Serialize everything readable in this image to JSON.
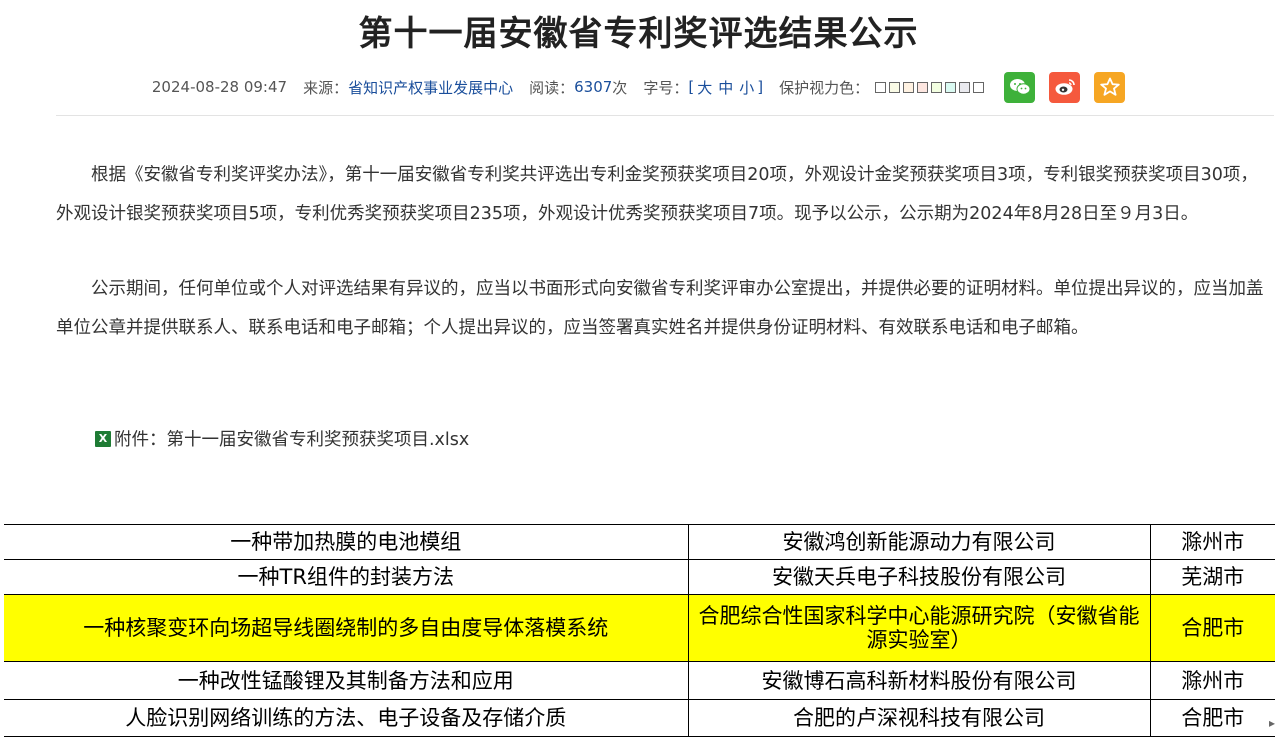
{
  "article": {
    "title": "第十一届安徽省专利奖评选结果公示",
    "date": "2024-08-28 09:47",
    "source_label": "来源：",
    "source": "省知识产权事业发展中心",
    "reads_label": "阅读：",
    "reads": "6307",
    "reads_unit": "次",
    "font_size_label": "字号：",
    "font_open": "[",
    "font_large": "大",
    "font_medium": "中",
    "font_small": "小",
    "font_close": "]",
    "eye_color_label": "保护视力色：",
    "eye_colors": [
      "#ffffff",
      "#fafbe6",
      "#fff2e2",
      "#fde6e0",
      "#f3ffe1",
      "#dafaf2",
      "#eaeaef",
      "#ffffff"
    ]
  },
  "share": {
    "wechat_icon": "wechat-icon",
    "weibo_icon": "weibo-icon",
    "favorite_icon": "star-icon",
    "wechat_color": "#3eb13a",
    "weibo_color": "#f5593d",
    "favorite_color": "#f6a623"
  },
  "content": {
    "paragraph1": "根据《安徽省专利奖评奖办法》，第十一届安徽省专利奖共评选出专利金奖预获奖项目20项，外观设计金奖预获奖项目3项，专利银奖预获奖项目30项，外观设计银奖预获奖项目5项，专利优秀奖预获奖项目235项，外观设计优秀奖预获奖项目7项。现予以公示，公示期为2024年8月28日至９月3日。",
    "paragraph2": "公示期间，任何单位或个人对评选结果有异议的，应当以书面形式向安徽省专利奖评审办公室提出，并提供必要的证明材料。单位提出异议的，应当加盖单位公章并提供联系人、联系电话和电子邮箱；个人提出异议的，应当签署真实姓名并提供身份证明材料、有效联系电话和电子邮箱。",
    "attachment_label": "附件：",
    "attachment_name": "第十一届安徽省专利奖预获奖项目.xlsx"
  },
  "table": {
    "highlight_color": "#ffff00",
    "rows": [
      {
        "project": "一种带加热膜的电池模组",
        "company": "安徽鸿创新能源动力有限公司",
        "city": "滁州市",
        "highlight": false
      },
      {
        "project": "一种TR组件的封装方法",
        "company": "安徽天兵电子科技股份有限公司",
        "city": "芜湖市",
        "highlight": false
      },
      {
        "project": "一种核聚变环向场超导线圈绕制的多自由度导体落模系统",
        "company": "合肥综合性国家科学中心能源研究院（安徽省能源实验室）",
        "city": "合肥市",
        "highlight": true
      },
      {
        "project": "一种改性锰酸锂及其制备方法和应用",
        "company": "安徽博石高科新材料股份有限公司",
        "city": "滁州市",
        "highlight": false
      },
      {
        "project": "人脸识别网络训练的方法、电子设备及存储介质",
        "company": "合肥的卢深视科技有限公司",
        "city": "合肥市",
        "highlight": false
      }
    ]
  }
}
